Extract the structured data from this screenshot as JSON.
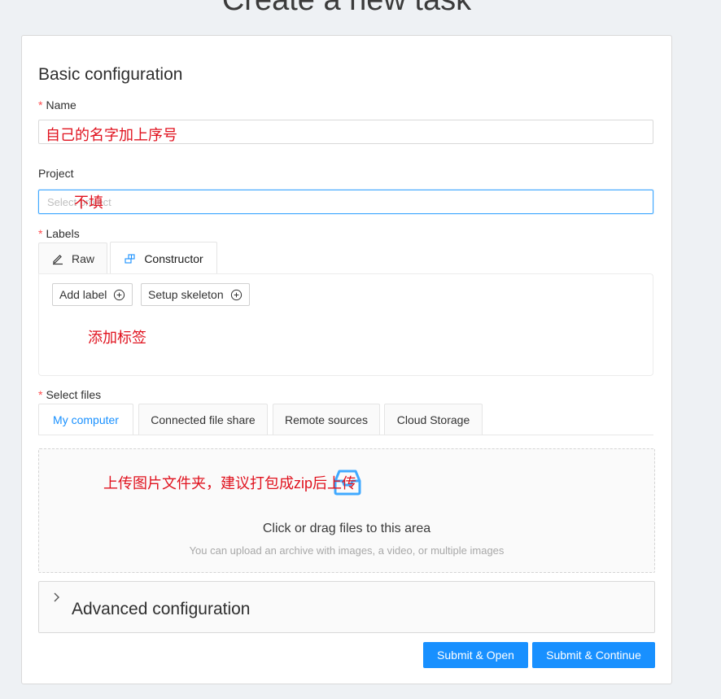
{
  "page": {
    "title": "Create a new task"
  },
  "basic": {
    "title": "Basic configuration"
  },
  "name_field": {
    "label": "Name",
    "required_mark": "*",
    "value": "自己的名字加上序号"
  },
  "project_field": {
    "label": "Project",
    "placeholder": "Select project",
    "annotation": "不填"
  },
  "labels_field": {
    "label": "Labels",
    "required_mark": "*",
    "tabs": [
      {
        "label": "Raw",
        "icon": "edit-icon"
      },
      {
        "label": "Constructor",
        "icon": "build-icon"
      }
    ],
    "add_label": "Add label",
    "setup_skeleton": "Setup skeleton",
    "annotation": "添加标签"
  },
  "files_field": {
    "label": "Select files",
    "required_mark": "*",
    "tabs": [
      "My computer",
      "Connected file share",
      "Remote sources",
      "Cloud Storage"
    ],
    "dropzone_title": "Click or drag files to this area",
    "dropzone_hint": "You can upload an archive with images, a video, or multiple images",
    "annotation": "上传图片文件夹，建议打包成zip后上传"
  },
  "advanced": {
    "title": "Advanced configuration"
  },
  "actions": {
    "submit_open": "Submit & Open",
    "submit_continue": "Submit & Continue"
  },
  "colors": {
    "accent": "#1890ff",
    "annotation": "#e0121e",
    "required": "#ff4d4f"
  }
}
